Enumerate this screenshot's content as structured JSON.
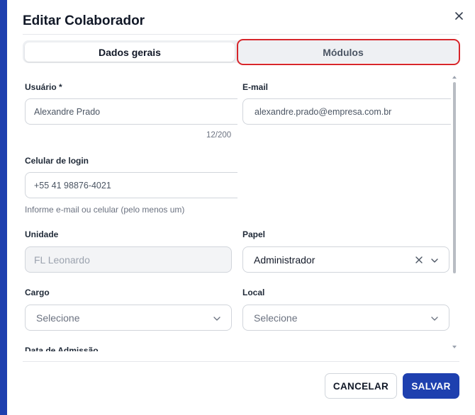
{
  "dialog": {
    "title": "Editar Colaborador",
    "close_icon": "close-icon"
  },
  "tabs": [
    {
      "label": "Dados gerais",
      "active": true
    },
    {
      "label": "Módulos",
      "active": false
    }
  ],
  "form": {
    "usuario": {
      "label": "Usuário *",
      "value": "Alexandre Prado",
      "counter": "12/200"
    },
    "email": {
      "label": "E-mail",
      "value": "alexandre.prado@empresa.com.br"
    },
    "celular": {
      "label": "Celular de login",
      "value": "+55 41 98876-4021",
      "hint": "Informe e-mail ou celular (pelo menos um)"
    },
    "unidade": {
      "label": "Unidade",
      "value": "FL Leonardo",
      "disabled": true
    },
    "papel": {
      "label": "Papel",
      "value": "Administrador"
    },
    "cargo": {
      "label": "Cargo",
      "placeholder": "Selecione"
    },
    "local": {
      "label": "Local",
      "placeholder": "Selecione"
    },
    "admissao": {
      "label": "Data de Admissão"
    }
  },
  "footer": {
    "cancel_label": "CANCELAR",
    "save_label": "SALVAR"
  },
  "colors": {
    "primary": "#1e40af",
    "highlight": "#d7262b"
  }
}
